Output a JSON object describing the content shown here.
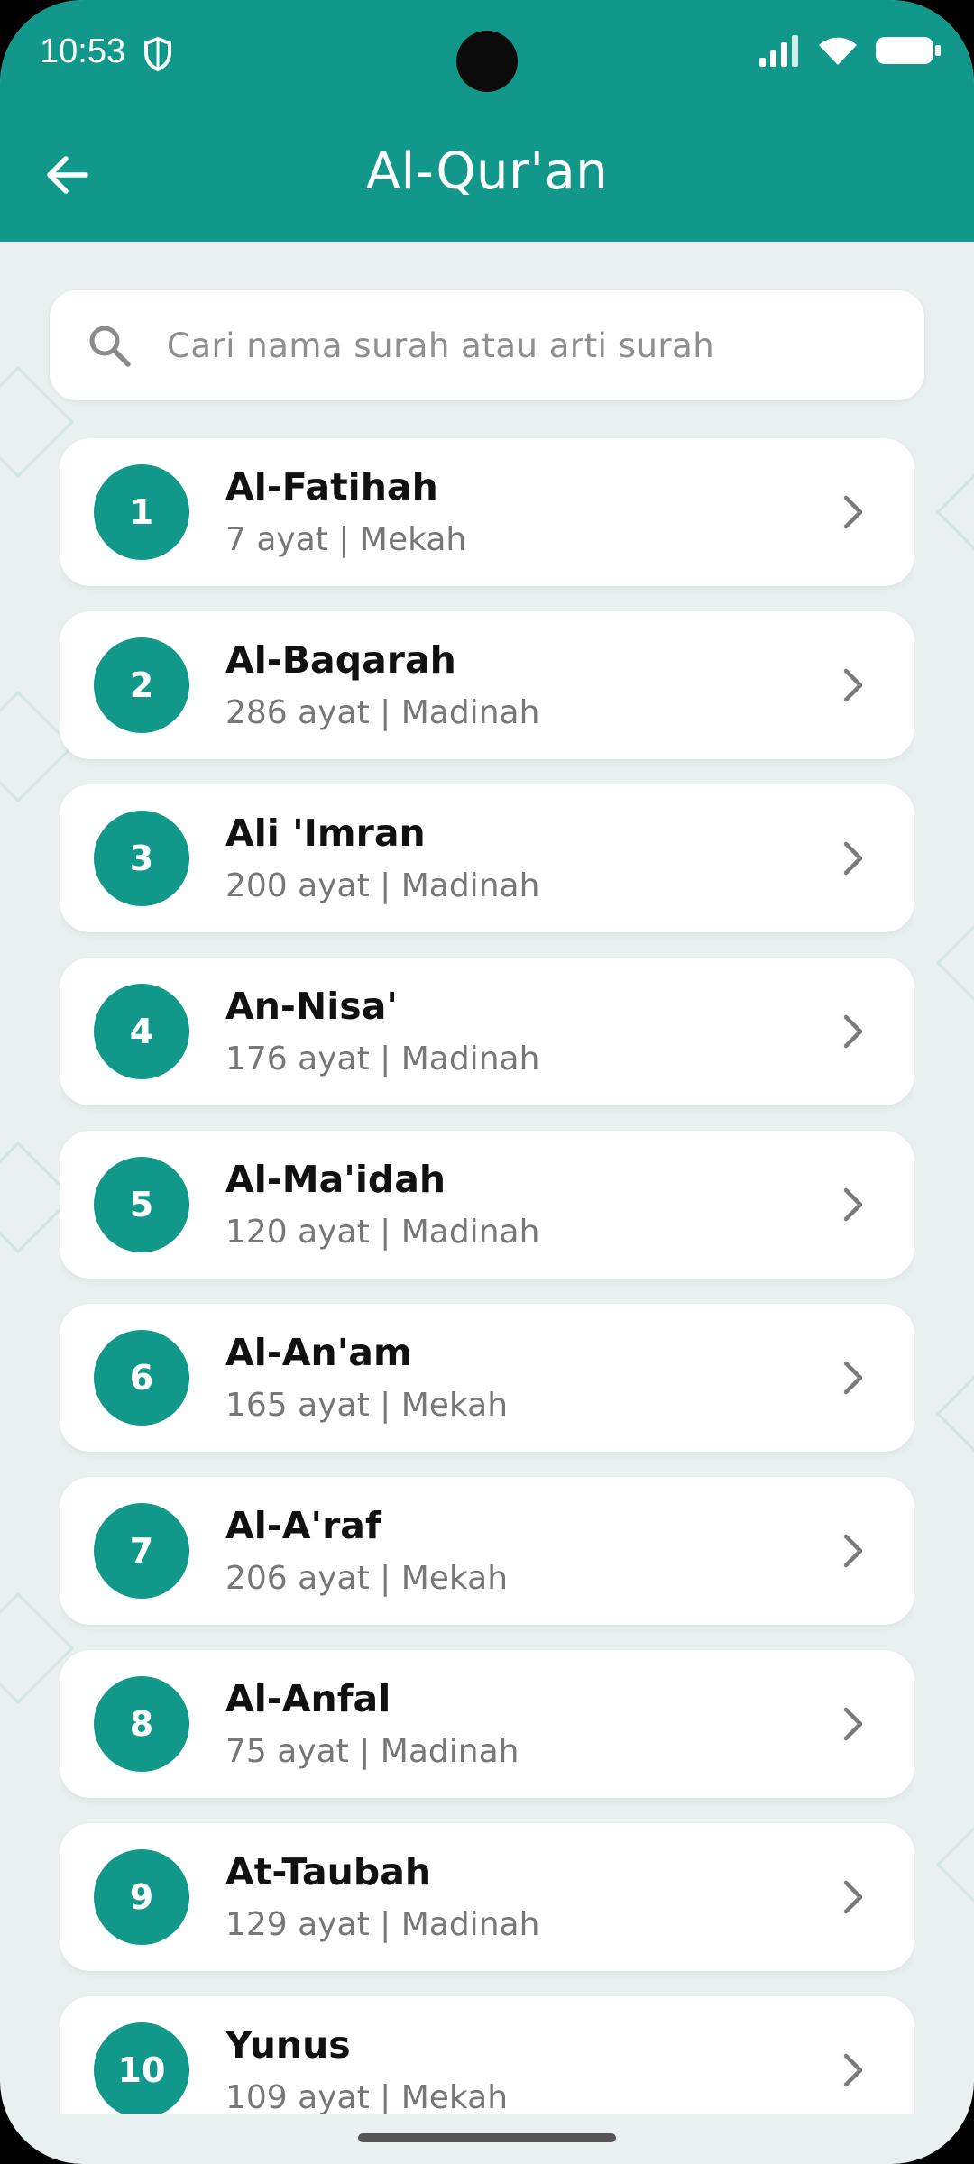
{
  "status": {
    "time": "10:53"
  },
  "appbar": {
    "title": "Al-Qur'an"
  },
  "search": {
    "placeholder": "Cari nama surah atau arti surah"
  },
  "surahs": [
    {
      "number": "1",
      "name": "Al-Fatihah",
      "info": "7 ayat | Mekah"
    },
    {
      "number": "2",
      "name": "Al-Baqarah",
      "info": "286 ayat | Madinah"
    },
    {
      "number": "3",
      "name": "Ali 'Imran",
      "info": "200 ayat | Madinah"
    },
    {
      "number": "4",
      "name": "An-Nisa'",
      "info": "176 ayat | Madinah"
    },
    {
      "number": "5",
      "name": "Al-Ma'idah",
      "info": "120 ayat | Madinah"
    },
    {
      "number": "6",
      "name": "Al-An'am",
      "info": "165 ayat | Mekah"
    },
    {
      "number": "7",
      "name": "Al-A'raf",
      "info": "206 ayat | Mekah"
    },
    {
      "number": "8",
      "name": "Al-Anfal",
      "info": "75 ayat | Madinah"
    },
    {
      "number": "9",
      "name": "At-Taubah",
      "info": "129 ayat | Madinah"
    },
    {
      "number": "10",
      "name": "Yunus",
      "info": "109 ayat | Mekah"
    }
  ],
  "icons": {
    "back": "arrow-left-icon",
    "search": "search-icon",
    "chevron": "chevron-right-icon",
    "shield": "shield-icon",
    "signal": "signal-icon",
    "wifi": "wifi-icon",
    "battery": "battery-icon"
  },
  "colors": {
    "primary": "#12988a",
    "background": "#e8f1ef",
    "card": "#ffffff"
  }
}
